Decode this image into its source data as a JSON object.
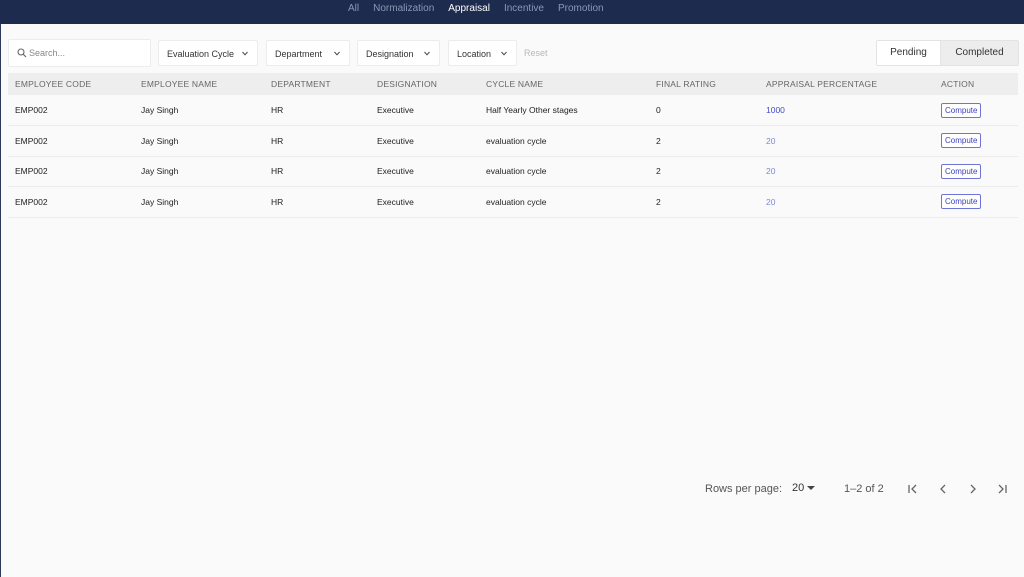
{
  "nav": {
    "tabs": [
      {
        "label": "All"
      },
      {
        "label": "Normalization"
      },
      {
        "label": "Appraisal"
      },
      {
        "label": "Incentive"
      },
      {
        "label": "Promotion"
      }
    ],
    "active_tab": "Appraisal"
  },
  "filters": {
    "search_placeholder": "Search...",
    "evaluation_cycle": "Evaluation Cycle",
    "department": "Department",
    "designation": "Designation",
    "location": "Location",
    "reset": "Reset"
  },
  "status_toggle": {
    "pending": "Pending",
    "completed": "Completed",
    "selected": "Pending"
  },
  "table": {
    "headers": {
      "employee_code": "EMPLOYEE CODE",
      "employee_name": "EMPLOYEE NAME",
      "department": "DEPARTMENT",
      "designation": "DESIGNATION",
      "cycle_name": "CYCLE NAME",
      "final_rating": "FINAL RATING",
      "appraisal_percentage": "APPRAISAL PERCENTAGE",
      "action": "ACTION"
    },
    "rows": [
      {
        "employee_code": "EMP002",
        "employee_name": "Jay Singh",
        "department": "HR",
        "designation": "Executive",
        "cycle_name": "Half Yearly Other stages",
        "final_rating": "0",
        "appraisal_percentage": "1000",
        "action": "Compute"
      },
      {
        "employee_code": "EMP002",
        "employee_name": "Jay Singh",
        "department": "HR",
        "designation": "Executive",
        "cycle_name": "evaluation cycle",
        "final_rating": "2",
        "appraisal_percentage": "20",
        "action": "Compute"
      },
      {
        "employee_code": "EMP002",
        "employee_name": "Jay Singh",
        "department": "HR",
        "designation": "Executive",
        "cycle_name": "evaluation cycle",
        "final_rating": "2",
        "appraisal_percentage": "20",
        "action": "Compute"
      },
      {
        "employee_code": "EMP002",
        "employee_name": "Jay Singh",
        "department": "HR",
        "designation": "Executive",
        "cycle_name": "evaluation cycle",
        "final_rating": "2",
        "appraisal_percentage": "20",
        "action": "Compute"
      }
    ]
  },
  "pagination": {
    "rows_per_page_label": "Rows per page:",
    "rows_per_page_value": "20",
    "range_text": "1–2 of 2"
  },
  "colors": {
    "topbar": "#1d2b4f",
    "accent": "#3f4ec7",
    "link_light": "#7d88d6"
  },
  "icons": [
    "search-icon",
    "chevron-down-icon",
    "first-page-icon",
    "prev-page-icon",
    "next-page-icon",
    "last-page-icon"
  ]
}
